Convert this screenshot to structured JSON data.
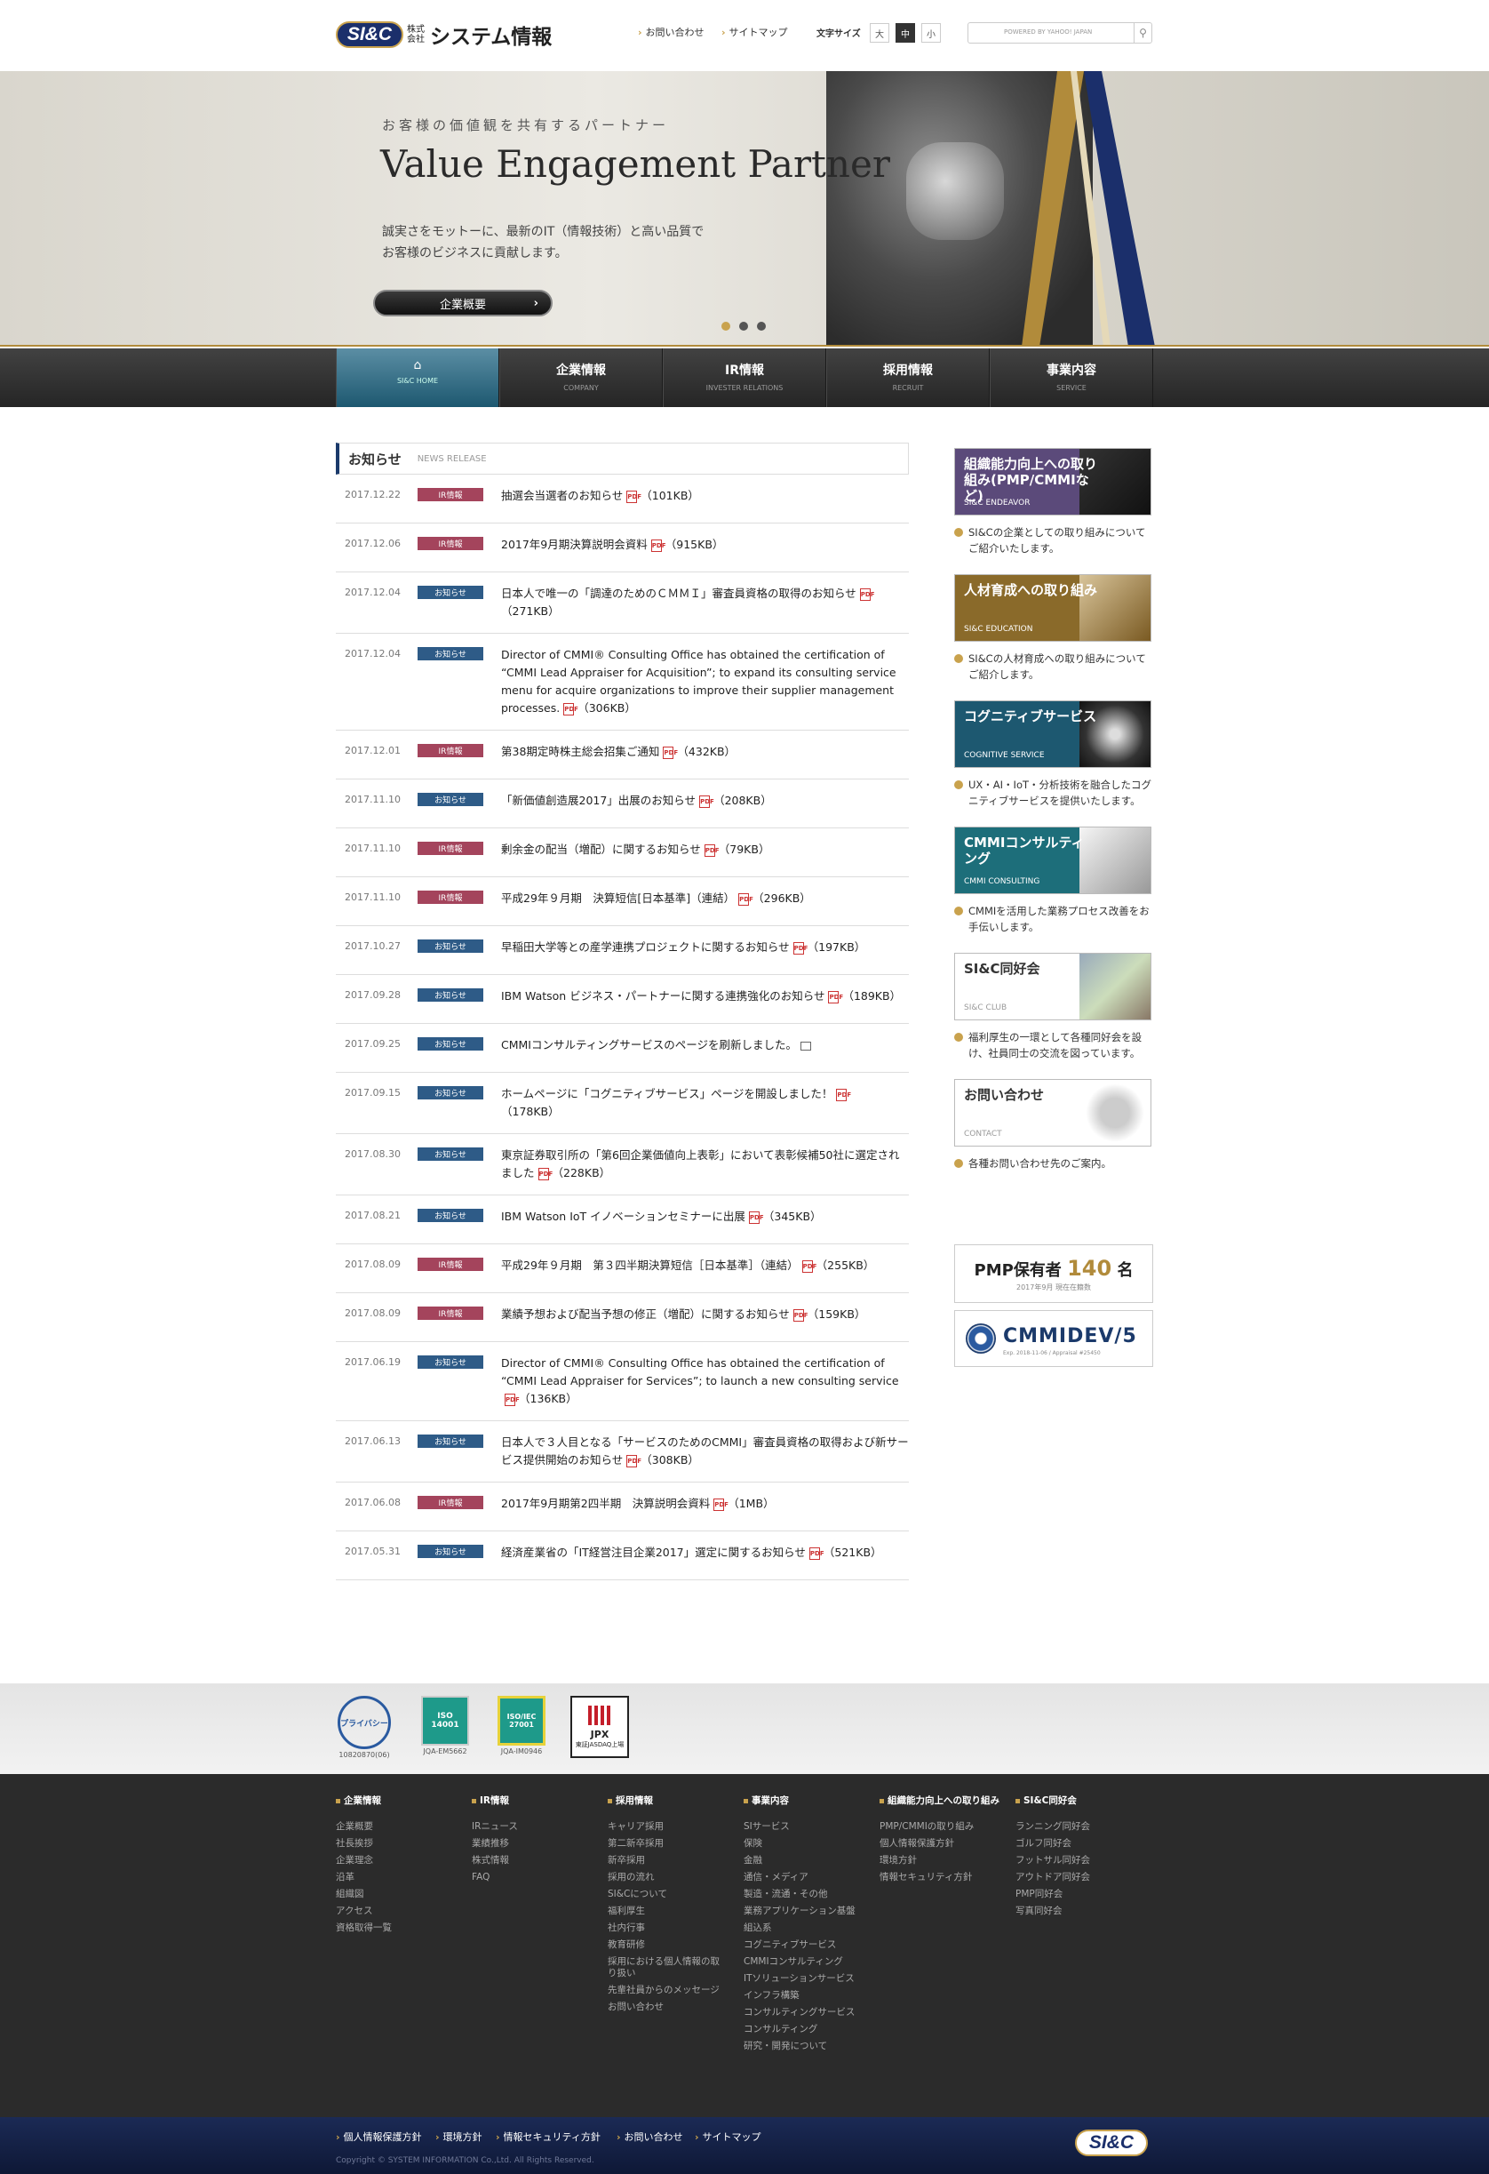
{
  "header": {
    "logo_mark": "SI&C",
    "logo_sub": "株式会社",
    "logo_name": "システム情報",
    "links": [
      "お問い合わせ",
      "サイトマップ"
    ],
    "font_size_label": "文字サイズ",
    "font_sizes": [
      "大",
      "中",
      "小"
    ],
    "search_placeholder": "POWERED BY YAHOO! JAPAN"
  },
  "hero": {
    "tagline": "お客様の価値観を共有するパートナー",
    "title": "Value Engagement Partner",
    "desc_line1": "誠実さをモットーに、最新のIT（情報技術）と高い品質で",
    "desc_line2": "お客様のビジネスに貢献します。",
    "button": "企業概要",
    "slides": 3,
    "active_slide": 1
  },
  "gnav": [
    {
      "jp": "",
      "en": "SI&C HOME",
      "icon": "home-icon"
    },
    {
      "jp": "企業情報",
      "en": "COMPANY"
    },
    {
      "jp": "IR情報",
      "en": "INVESTER RELATIONS"
    },
    {
      "jp": "採用情報",
      "en": "RECRUIT"
    },
    {
      "jp": "事業内容",
      "en": "SERVICE"
    }
  ],
  "news": {
    "title": "お知らせ",
    "subtitle": "NEWS RELEASE",
    "items": [
      {
        "date": "2017.12.22",
        "cat": "IR情報",
        "text": "抽選会当選者のお知らせ",
        "size": "（101KB）"
      },
      {
        "date": "2017.12.06",
        "cat": "IR情報",
        "text": "2017年9月期決算説明会資料",
        "size": "（915KB）"
      },
      {
        "date": "2017.12.04",
        "cat": "お知らせ",
        "text": "日本人で唯一の「調達のためのＣＭＭＩ」審査員資格の取得のお知らせ",
        "size": "（271KB）"
      },
      {
        "date": "2017.12.04",
        "cat": "お知らせ",
        "text": "Director of CMMI® Consulting Office has obtained the certification of “CMMI Lead Appraiser for Acquisition”; to expand its consulting service menu for acquire organizations to improve their supplier management processes.",
        "size": "（306KB）"
      },
      {
        "date": "2017.12.01",
        "cat": "IR情報",
        "text": "第38期定時株主総会招集ご通知",
        "size": "（432KB）"
      },
      {
        "date": "2017.11.10",
        "cat": "お知らせ",
        "text": "「新価値創造展2017」出展のお知らせ",
        "size": "（208KB）"
      },
      {
        "date": "2017.11.10",
        "cat": "IR情報",
        "text": "剰余金の配当（増配）に関するお知らせ",
        "size": "（79KB）"
      },
      {
        "date": "2017.11.10",
        "cat": "IR情報",
        "text": "平成29年９月期　決算短信[日本基準]（連結）",
        "size": "（296KB）"
      },
      {
        "date": "2017.10.27",
        "cat": "お知らせ",
        "text": "早稲田大学等との産学連携プロジェクトに関するお知らせ",
        "size": "（197KB）"
      },
      {
        "date": "2017.09.28",
        "cat": "お知らせ",
        "text": "IBM Watson ビジネス・パートナーに関する連携強化のお知らせ",
        "size": "（189KB）"
      },
      {
        "date": "2017.09.25",
        "cat": "お知らせ",
        "text": "CMMIコンサルティングサービスのページを刷新しました。",
        "size": ""
      },
      {
        "date": "2017.09.15",
        "cat": "お知らせ",
        "text": "ホームページに「コグニティブサービス」ページを開設しました！",
        "size": "（178KB）"
      },
      {
        "date": "2017.08.30",
        "cat": "お知らせ",
        "text": "東京証券取引所の「第6回企業価値向上表彰」において表彰候補50社に選定されました",
        "size": "（228KB）"
      },
      {
        "date": "2017.08.21",
        "cat": "お知らせ",
        "text": "IBM Watson IoT イノベーションセミナーに出展",
        "size": "（345KB）"
      },
      {
        "date": "2017.08.09",
        "cat": "IR情報",
        "text": "平成29年９月期　第３四半期決算短信［日本基準］（連結）",
        "size": "（255KB）"
      },
      {
        "date": "2017.08.09",
        "cat": "IR情報",
        "text": "業績予想および配当予想の修正（増配）に関するお知らせ",
        "size": "（159KB）"
      },
      {
        "date": "2017.06.19",
        "cat": "お知らせ",
        "text": "Director of CMMI® Consulting Office has obtained the certification of “CMMI Lead Appraiser for Services”; to launch a new consulting service",
        "size": "（136KB）"
      },
      {
        "date": "2017.06.13",
        "cat": "お知らせ",
        "text": "日本人で３人目となる「サービスのためのCMMI」審査員資格の取得および新サービス提供開始のお知らせ",
        "size": "（308KB）"
      },
      {
        "date": "2017.06.08",
        "cat": "IR情報",
        "text": "2017年9月期第2四半期　決算説明会資料",
        "size": "（1MB）"
      },
      {
        "date": "2017.05.31",
        "cat": "お知らせ",
        "text": "経済産業省の「IT経営注目企業2017」選定に関するお知らせ",
        "size": "（521KB）"
      }
    ]
  },
  "side": {
    "banners": [
      {
        "title": "組織能力向上への取り組み(PMP/CMMIなど)",
        "sub": "SI&C ENDEAVOR",
        "desc": "SI&Cの企業としての取り組みについてご紹介いたします。",
        "color": "#5b4a7a"
      },
      {
        "title": "人材育成への取り組み",
        "sub": "SI&C EDUCATION",
        "desc": "SI&Cの人材育成への取り組みについてご紹介します。",
        "color": "#8a6a2a"
      },
      {
        "title": "コグニティブサービス",
        "sub": "COGNITIVE SERVICE",
        "desc": "UX・AI・IoT・分析技術を融合したコグニティブサービスを提供いたします。",
        "color": "#1d5870"
      },
      {
        "title": "CMMIコンサルティング",
        "sub": "CMMI CONSULTING",
        "desc": "CMMIを活用した業務プロセス改善をお手伝いします。",
        "color": "#1d6e7a"
      },
      {
        "title": "SI&C同好会",
        "sub": "SI&C CLUB",
        "desc": "福利厚生の一環として各種同好会を設け、社員同士の交流を図っています。",
        "color": "#ffffff"
      },
      {
        "title": "お問い合わせ",
        "sub": "CONTACT",
        "desc": "各種お問い合わせ先のご案内。",
        "color": "#ffffff"
      }
    ],
    "pmp_label": "PMP保有者",
    "pmp_count": "140",
    "pmp_unit": "名",
    "pmp_note": "2017年9月 現在在籍数",
    "cmmi_title": "CMMIDEV/5",
    "cmmi_note": "Exp. 2018-11-06 / Appraisal #25450"
  },
  "certs": [
    {
      "name": "プライバシー",
      "cap": "10820870(06)"
    },
    {
      "name": "ISO 14001",
      "cap": "JQA-EM5662"
    },
    {
      "name": "ISO/IEC 27001",
      "cap": "JQA-IM0946"
    },
    {
      "name": "JPX",
      "cap": "東証JASDAQ上場"
    }
  ],
  "footer_nav": [
    {
      "head": "企業情報",
      "items": [
        "企業概要",
        "社長挨拶",
        "企業理念",
        "沿革",
        "組織図",
        "アクセス",
        "資格取得一覧"
      ]
    },
    {
      "head": "IR情報",
      "items": [
        "IRニュース",
        "業績推移",
        "株式情報",
        "FAQ"
      ]
    },
    {
      "head": "採用情報",
      "items": [
        "キャリア採用",
        "第二新卒採用",
        "新卒採用",
        "採用の流れ",
        "SI&Cについて",
        "福利厚生",
        "社内行事",
        "教育研修",
        "採用における個人情報の取り扱い",
        "先輩社員からのメッセージ",
        "お問い合わせ"
      ]
    },
    {
      "head": "事業内容",
      "items": [
        "SIサービス",
        "保険",
        "金融",
        "通信・メディア",
        "製造・流通・その他",
        "業務アプリケーション基盤",
        "組込系",
        "コグニティブサービス",
        "CMMIコンサルティング",
        "ITソリューションサービス",
        "インフラ構築",
        "コンサルティングサービス",
        "コンサルティング",
        "研究・開発について"
      ]
    },
    {
      "head": "組織能力向上への取り組み",
      "items": [
        "PMP/CMMIの取り組み",
        "個人情報保護方針",
        "環境方針",
        "情報セキュリティ方針"
      ]
    },
    {
      "head": "SI&C同好会",
      "items": [
        "ランニング同好会",
        "ゴルフ同好会",
        "フットサル同好会",
        "アウトドア同好会",
        "PMP同好会",
        "写真同好会"
      ]
    }
  ],
  "footer_bar": {
    "links": [
      "個人情報保護方針",
      "環境方針",
      "情報セキュリティ方針",
      "お問い合わせ",
      "サイトマップ"
    ],
    "copyright": "Copyright © SYSTEM INFORMATION Co.,Ltd. All Rights Reserved.",
    "logo": "SI&C"
  },
  "colors": {
    "ir": "#a4445c",
    "info": "#2e5b87",
    "gold": "#c9a24d",
    "navy": "#1b2f6b"
  }
}
